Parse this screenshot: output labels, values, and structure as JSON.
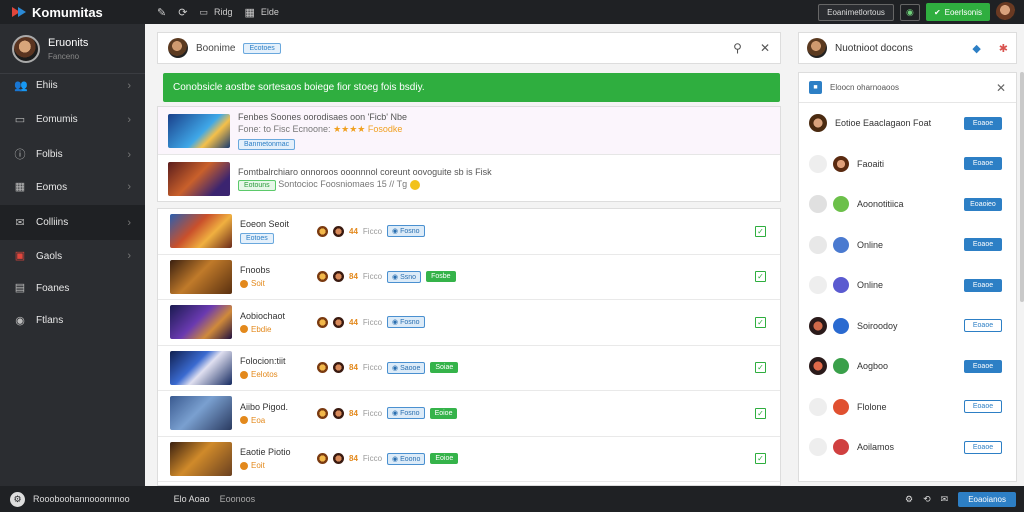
{
  "app": {
    "title": "Komumitas"
  },
  "profile": {
    "name": "Eruonits",
    "subtitle": "Fanceno"
  },
  "sidebar": {
    "items": [
      {
        "label": "Ehiis",
        "icon": "users-icon"
      },
      {
        "label": "Eomumis",
        "icon": "window-icon"
      },
      {
        "label": "Folbis",
        "icon": "info-icon"
      },
      {
        "label": "Eomos",
        "icon": "grid-icon"
      },
      {
        "label": "Colliins",
        "icon": "chat-icon"
      },
      {
        "label": "Gaols",
        "icon": "box-icon"
      },
      {
        "label": "Foanes",
        "icon": "book-icon"
      },
      {
        "label": "Ftlans",
        "icon": "badge-icon"
      }
    ]
  },
  "topbar": {
    "icons": [
      "edit-icon",
      "refresh-icon"
    ],
    "links": [
      "Ridg",
      "Elde"
    ],
    "menu_button": "Eoanimetlortous",
    "green_button": "Eoerlsonis"
  },
  "search": {
    "label": "Boonime",
    "chip": "Ecotoes"
  },
  "banner": {
    "text": "Conobsicle aostbe sortesaos boiege fior stoeg fois bsdiy."
  },
  "news": [
    {
      "line1": "Fenbes Soones oorodisaes oon 'Ficb' Nbe",
      "line2": "Fone: to Fisc Ecnoone:",
      "stars": "★★★★",
      "line2_end": "Fosodke",
      "chip": "Banmetonmac",
      "chip_type": "blue"
    },
    {
      "line1": "Fomtbalrchiaro onnoroos ooonnnol coreunt oovoguite sb is Fisk",
      "line2": "Sontocioc Foosniomaes 15 // Tg",
      "chip": "Eotouns",
      "chip_type": "green"
    }
  ],
  "games": [
    {
      "name": "Eoeon Seoit",
      "sub": "Eotoes",
      "sub_type": "chip",
      "score": "44",
      "label": "Ficco",
      "tag": "Fosno",
      "green": ""
    },
    {
      "name": "Fnoobs",
      "sub": "Soit",
      "sub_type": "text",
      "score": "84",
      "label": "Ficco",
      "tag": "Ssno",
      "green": "Fosbe"
    },
    {
      "name": "Aobiochaot",
      "sub": "Ebdie",
      "sub_type": "text",
      "score": "44",
      "label": "Ficco",
      "tag": "Fosno",
      "green": ""
    },
    {
      "name": "Folocion:tiit",
      "sub": "Eelotos",
      "sub_type": "text",
      "score": "84",
      "label": "Ficco",
      "tag": "Saooe",
      "green": "Soiae"
    },
    {
      "name": "Aiibo Pigod.",
      "sub": "Eoa",
      "sub_type": "text",
      "score": "84",
      "label": "Ficco",
      "tag": "Fosno",
      "green": "Eoioe"
    },
    {
      "name": "Eaotie Piotio",
      "sub": "Eoit",
      "sub_type": "text",
      "score": "84",
      "label": "Ficco",
      "tag": "Eoono",
      "green": "Eoioe"
    }
  ],
  "right": {
    "title": "Nuotnioot docons",
    "search_text": "Eloocn oharnoaoos",
    "friends": [
      {
        "name": "Eotioe Eaaclagaon Foat",
        "button": "Eoaoe",
        "style": "solid"
      },
      {
        "name": "Faoaiti",
        "button": "Eoaoe",
        "style": "solid"
      },
      {
        "name": "Aoonotitiica",
        "button": "Eoaoieo",
        "style": "solid"
      },
      {
        "name": "Online",
        "button": "Eoaoe",
        "style": "solid"
      },
      {
        "name": "Online",
        "button": "Eoaoe",
        "style": "solid"
      },
      {
        "name": "Soiroodoy",
        "button": "Eoaoe",
        "style": "outline"
      },
      {
        "name": "Aogboo",
        "button": "Eoaoe",
        "style": "solid"
      },
      {
        "name": "Flolone",
        "button": "Eoaoe",
        "style": "outline"
      },
      {
        "name": "Aoilamos",
        "button": "Eoaoe",
        "style": "outline"
      }
    ]
  },
  "bottombar": {
    "status": "Roooboohannooonnnoo",
    "item1": "Elo Aoao",
    "item2": "Eoonoos",
    "button": "Eoaoianos"
  },
  "colors": {
    "accent_green": "#2fae3f",
    "accent_blue": "#2d7fc5",
    "sidebar": "#2b2d31",
    "topbar": "#1f2124"
  }
}
